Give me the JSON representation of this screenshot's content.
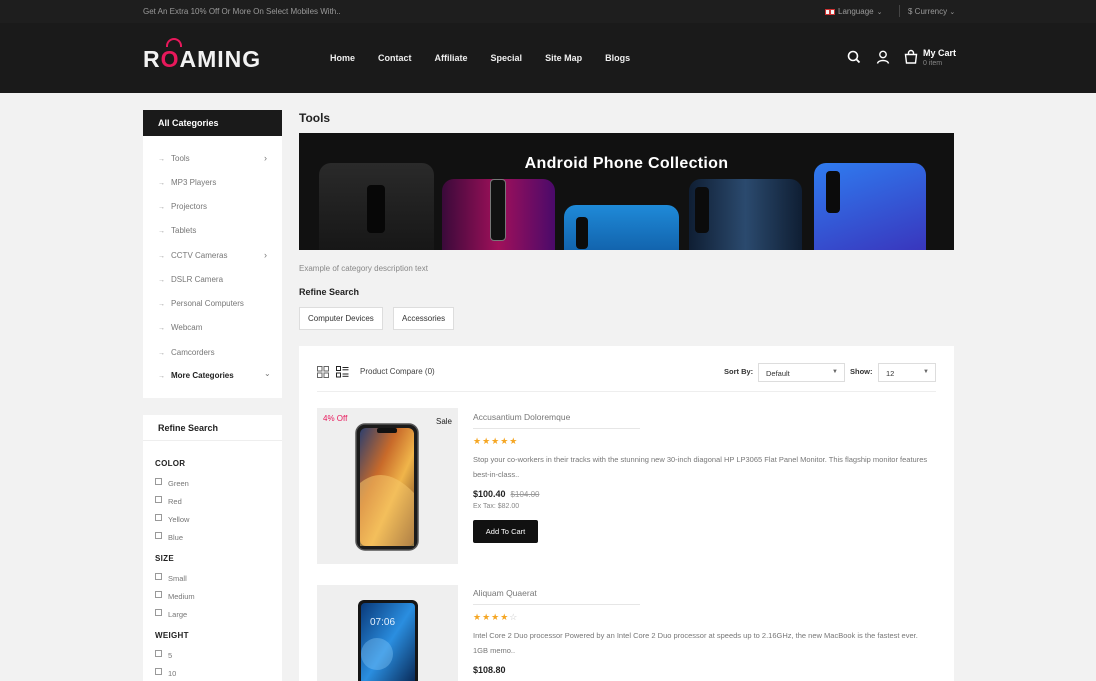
{
  "topbar": {
    "promo": "Get An Extra 10% Off Or More On Select Mobiles With..",
    "language": "Language",
    "currency": "$ Currency"
  },
  "header": {
    "logo_pre": "R",
    "logo_o": "O",
    "logo_post": "AMING",
    "nav": [
      "Home",
      "Contact",
      "Affiliate",
      "Special",
      "Site Map",
      "Blogs"
    ],
    "cart_label": "My Cart",
    "cart_count": "0 item",
    "icons": [
      "search-icon",
      "user-icon",
      "cart-icon"
    ]
  },
  "sidebar": {
    "categories_title": "All Categories",
    "categories": [
      {
        "label": "Tools",
        "has_sub": true
      },
      {
        "label": "MP3 Players",
        "has_sub": false
      },
      {
        "label": "Projectors",
        "has_sub": false
      },
      {
        "label": "Tablets",
        "has_sub": false
      },
      {
        "label": "CCTV Cameras",
        "has_sub": true
      },
      {
        "label": "DSLR Camera",
        "has_sub": false
      },
      {
        "label": "Personal Computers",
        "has_sub": false
      },
      {
        "label": "Webcam",
        "has_sub": false
      },
      {
        "label": "Camcorders",
        "has_sub": false
      }
    ],
    "more_categories": "More Categories",
    "refine_title": "Refine Search",
    "filters": {
      "color_title": "COLOR",
      "colors": [
        "Green",
        "Red",
        "Yellow",
        "Blue"
      ],
      "size_title": "SIZE",
      "sizes": [
        "Small",
        "Medium",
        "Large"
      ],
      "weight_title": "WEIGHT",
      "weights": [
        "5",
        "10"
      ]
    }
  },
  "main": {
    "title": "Tools",
    "banner_title": "Android Phone Collection",
    "description": "Example of category description text",
    "refine_title": "Refine Search",
    "chips": [
      "Computer Devices",
      "Accessories"
    ],
    "toolbar": {
      "compare": "Product Compare (0)",
      "sort_label": "Sort By:",
      "sort_value": "Default",
      "show_label": "Show:",
      "show_value": "12"
    },
    "products": [
      {
        "name": "Accusantium Doloremque",
        "badge_off": "4% Off",
        "badge_sale": "Sale",
        "rating": 5,
        "stars": "★★★★★",
        "stars_empty": "",
        "description": "Stop your co-workers in their tracks with the stunning new 30-inch diagonal HP LP3065 Flat Panel Monitor. This flagship monitor features best-in-class..",
        "price": "$100.40",
        "old_price": "$104.00",
        "tax": "Ex Tax: $82.00",
        "button": "Add To Cart"
      },
      {
        "name": "Aliquam Quaerat",
        "rating": 4,
        "stars": "★★★★",
        "stars_empty": "☆",
        "description": "Intel Core 2 Duo processor Powered by an Intel Core 2 Duo processor at speeds up to 2.16GHz, the new MacBook is the fastest ever. 1GB memo..",
        "price": "$108.80",
        "phone_time": "07:06"
      }
    ]
  },
  "colors": {
    "accent": "#e8185b",
    "header_bg": "#1a1a1a",
    "star": "#f5a623"
  }
}
